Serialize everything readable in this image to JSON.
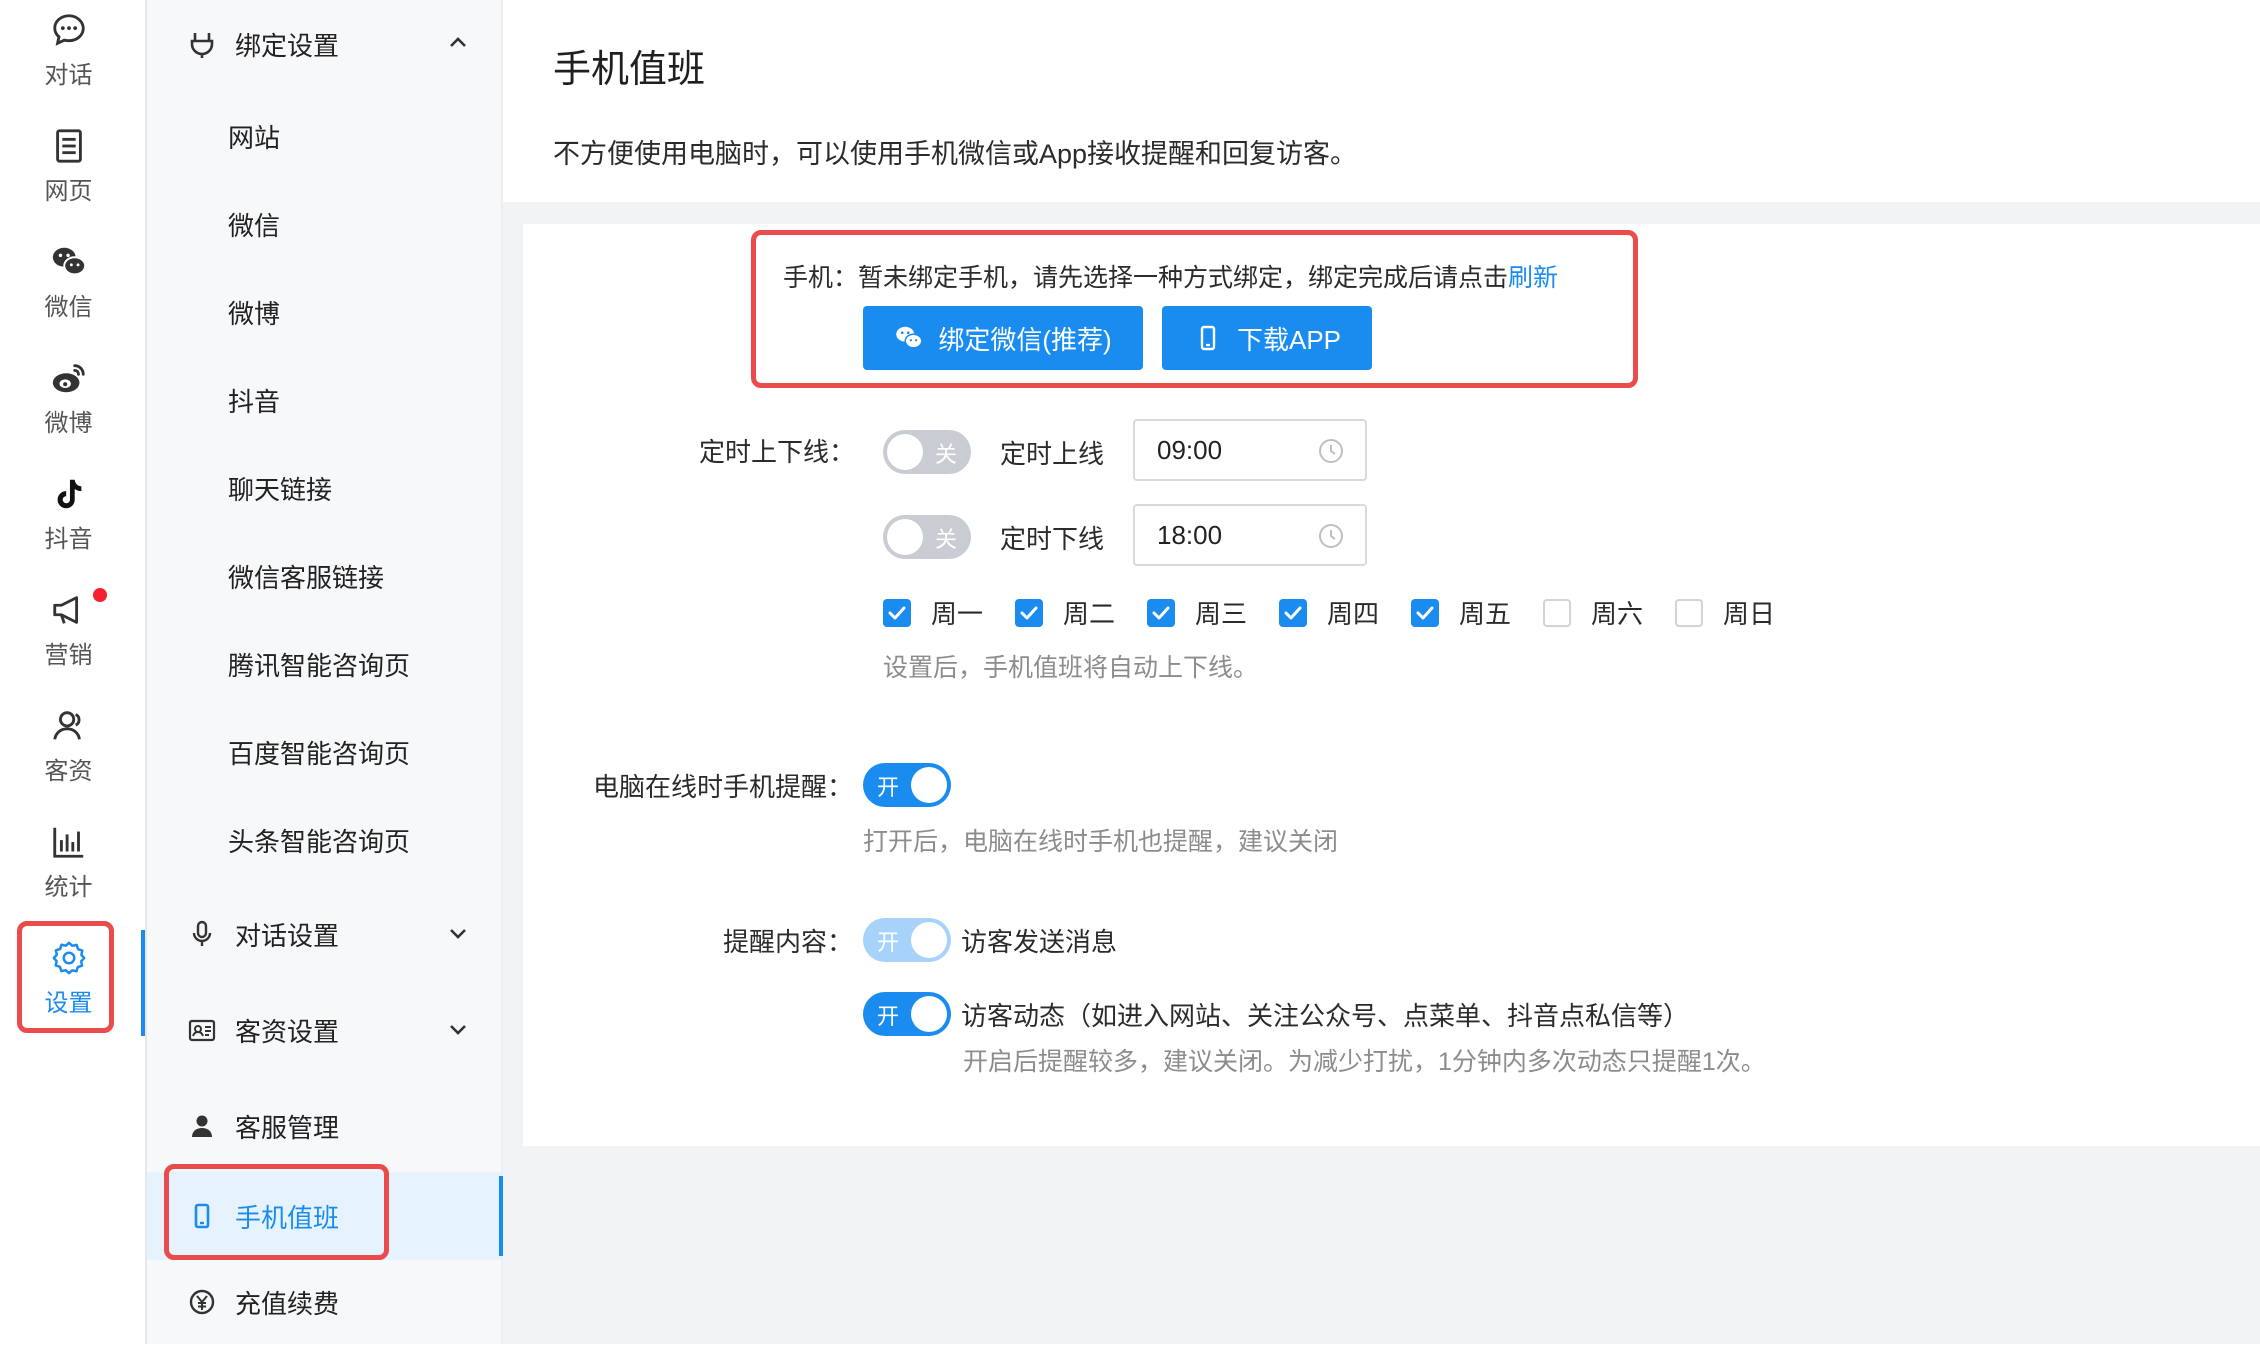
{
  "rail": {
    "items": [
      {
        "label": "对话",
        "icon": "chat-bubble-icon"
      },
      {
        "label": "网页",
        "icon": "webpage-icon"
      },
      {
        "label": "微信",
        "icon": "wechat-icon"
      },
      {
        "label": "微博",
        "icon": "weibo-icon"
      },
      {
        "label": "抖音",
        "icon": "douyin-icon"
      },
      {
        "label": "营销",
        "icon": "megaphone-icon"
      },
      {
        "label": "客资",
        "icon": "customer-icon"
      },
      {
        "label": "统计",
        "icon": "statistics-icon"
      },
      {
        "label": "设置",
        "icon": "gear-icon"
      }
    ],
    "active": "设置"
  },
  "menu": {
    "bind_group": "绑定设置",
    "bind_items": [
      "网站",
      "微信",
      "微博",
      "抖音",
      "聊天链接",
      "微信客服链接",
      "腾讯智能咨询页",
      "百度智能咨询页",
      "头条智能咨询页"
    ],
    "dialog_group": "对话设置",
    "customer_group": "客资设置",
    "service_item": "客服管理",
    "duty_item": "手机值班",
    "recharge_item": "充值续费"
  },
  "page": {
    "title": "手机值班",
    "desc": "不方便使用电脑时，可以使用手机微信或App接收提醒和回复访客。"
  },
  "phone": {
    "text": "手机：暂未绑定手机，请先选择一种方式绑定，绑定完成后请点击",
    "refresh_link": "刷新",
    "bind_wechat_btn": "绑定微信(推荐)",
    "download_app_btn": "下载APP"
  },
  "schedule": {
    "label": "定时上下线：",
    "online_switch": "关",
    "online_label": "定时上线",
    "online_time": "09:00",
    "offline_switch": "关",
    "offline_label": "定时下线",
    "offline_time": "18:00",
    "days": [
      {
        "label": "周一",
        "checked": true
      },
      {
        "label": "周二",
        "checked": true
      },
      {
        "label": "周三",
        "checked": true
      },
      {
        "label": "周四",
        "checked": true
      },
      {
        "label": "周五",
        "checked": true
      },
      {
        "label": "周六",
        "checked": false
      },
      {
        "label": "周日",
        "checked": false
      }
    ],
    "hint": "设置后，手机值班将自动上下线。"
  },
  "pc_online": {
    "label": "电脑在线时手机提醒：",
    "switch": "开",
    "hint": "打开后，电脑在线时手机也提醒，建议关闭"
  },
  "remind": {
    "label": "提醒内容：",
    "msg_switch": "开",
    "msg_label": "访客发送消息",
    "dyn_switch": "开",
    "dyn_label": "访客动态（如进入网站、关注公众号、点菜单、抖音点私信等）",
    "dyn_hint": "开启后提醒较多，建议关闭。为减少打扰，1分钟内多次动态只提醒1次。"
  },
  "colors": {
    "accent": "#1a8cf0",
    "highlight": "#ea4b4b",
    "badge": "#f5222d"
  }
}
